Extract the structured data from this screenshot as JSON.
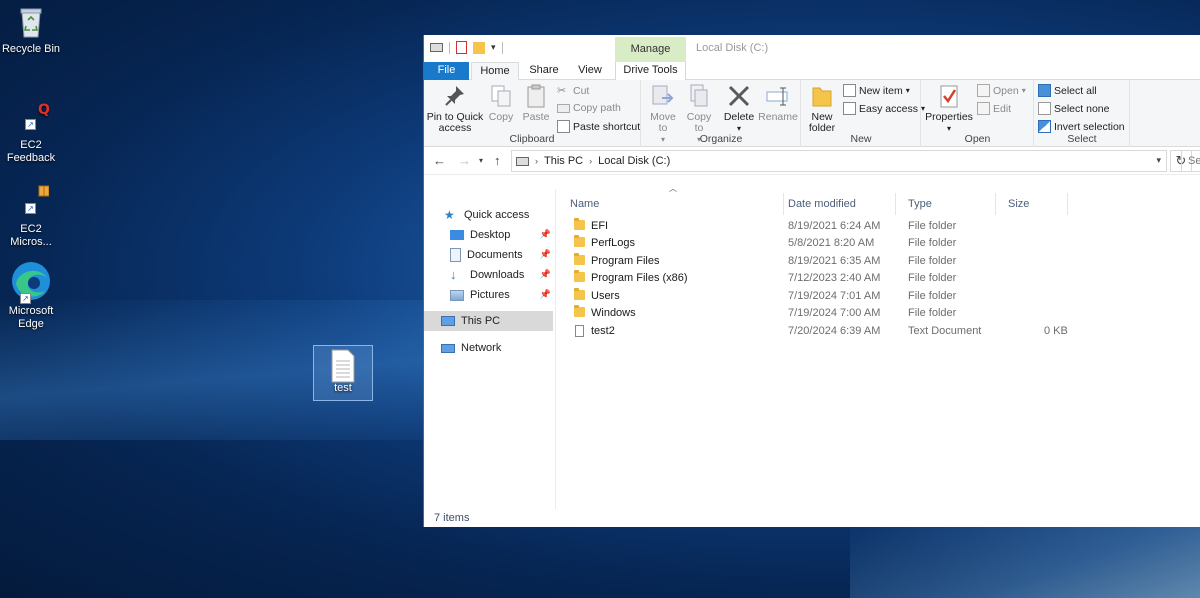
{
  "desktop": {
    "icons": [
      {
        "label": "Recycle Bin",
        "icon": "recycle-bin-icon"
      },
      {
        "label": "EC2 Feedback",
        "icon": "ec2-feedback-icon"
      },
      {
        "label": "EC2 Micros...",
        "icon": "ec2-microsoft-icon"
      },
      {
        "label": "Microsoft Edge",
        "icon": "edge-icon"
      },
      {
        "label": "test",
        "icon": "text-document-icon"
      }
    ]
  },
  "explorer": {
    "contextual_tab_group": "Manage",
    "window_title": "Local Disk (C:)",
    "tabs": {
      "file": "File",
      "home": "Home",
      "share": "Share",
      "view": "View",
      "drive_tools": "Drive Tools"
    },
    "ribbon": {
      "clipboard": {
        "label": "Clipboard",
        "pin": "Pin to Quick access",
        "copy": "Copy",
        "paste": "Paste",
        "cut": "Cut",
        "copy_path": "Copy path",
        "paste_shortcut": "Paste shortcut"
      },
      "organize": {
        "label": "Organize",
        "move_to": "Move to",
        "copy_to": "Copy to",
        "delete": "Delete",
        "rename": "Rename"
      },
      "new": {
        "label": "New",
        "new_folder": "New folder",
        "new_item": "New item",
        "easy_access": "Easy access"
      },
      "open": {
        "label": "Open",
        "properties": "Properties",
        "open": "Open",
        "edit": "Edit"
      },
      "select": {
        "label": "Select",
        "select_all": "Select all",
        "select_none": "Select none",
        "invert": "Invert selection"
      }
    },
    "address": {
      "crumbs": [
        "This PC",
        "Local Disk (C:)"
      ],
      "search_placeholder": "Search"
    },
    "nav": {
      "quick_access": "Quick access",
      "desktop": "Desktop",
      "documents": "Documents",
      "downloads": "Downloads",
      "pictures": "Pictures",
      "this_pc": "This PC",
      "network": "Network"
    },
    "columns": {
      "name": "Name",
      "date": "Date modified",
      "type": "Type",
      "size": "Size"
    },
    "files": [
      {
        "name": "EFI",
        "date": "8/19/2021 6:24 AM",
        "type": "File folder",
        "size": "",
        "kind": "folder"
      },
      {
        "name": "PerfLogs",
        "date": "5/8/2021 8:20 AM",
        "type": "File folder",
        "size": "",
        "kind": "folder"
      },
      {
        "name": "Program Files",
        "date": "8/19/2021 6:35 AM",
        "type": "File folder",
        "size": "",
        "kind": "folder"
      },
      {
        "name": "Program Files (x86)",
        "date": "7/12/2023 2:40 AM",
        "type": "File folder",
        "size": "",
        "kind": "folder"
      },
      {
        "name": "Users",
        "date": "7/19/2024 7:01 AM",
        "type": "File folder",
        "size": "",
        "kind": "folder"
      },
      {
        "name": "Windows",
        "date": "7/19/2024 7:00 AM",
        "type": "File folder",
        "size": "",
        "kind": "folder"
      },
      {
        "name": "test2",
        "date": "7/20/2024 6:39 AM",
        "type": "Text Document",
        "size": "0 KB",
        "kind": "file"
      }
    ],
    "status": "7 items"
  },
  "colors": {
    "file_tab": "#1979ca",
    "manage_tab": "#d8ecc5",
    "folder": "#f4c44b",
    "header_text": "#4c607a"
  }
}
